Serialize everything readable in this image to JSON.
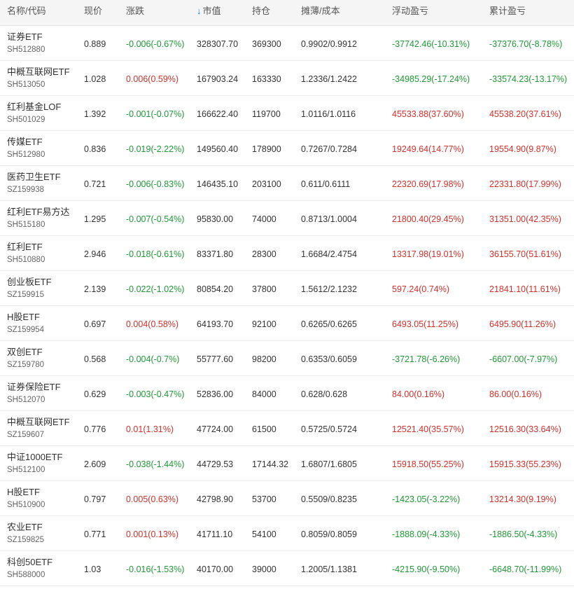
{
  "colors": {
    "up": "#d5302a",
    "down": "#1f9a36",
    "sort_arrow": "#1e78d6"
  },
  "header": {
    "name_code": "名称/代码",
    "price": "现价",
    "change": "涨跌",
    "sort_icon": "arrow-down-icon",
    "sort_arrow": "↓",
    "market_value": "市值",
    "quantity": "持仓",
    "cost": "摊薄/成本",
    "floating_pl": "浮动盈亏",
    "total_pl": "累计盈亏"
  },
  "rows": [
    {
      "name": "证券ETF",
      "code": "SH512880",
      "price": "0.889",
      "change": "-0.006(-0.67%)",
      "change_dir": "down",
      "market_value": "328307.70",
      "quantity": "369300",
      "cost": "0.9902/0.9912",
      "floating_pl": "-37742.46(-10.31%)",
      "floating_dir": "down",
      "total_pl": "-37376.70(-8.78%)",
      "total_dir": "down"
    },
    {
      "name": "中概互联网ETF",
      "code": "SH513050",
      "price": "1.028",
      "change": "0.006(0.59%)",
      "change_dir": "up",
      "market_value": "167903.24",
      "quantity": "163330",
      "cost": "1.2336/1.2422",
      "floating_pl": "-34985.29(-17.24%)",
      "floating_dir": "down",
      "total_pl": "-33574.23(-13.17%)",
      "total_dir": "down"
    },
    {
      "name": "红利基金LOF",
      "code": "SH501029",
      "price": "1.392",
      "change": "-0.001(-0.07%)",
      "change_dir": "down",
      "market_value": "166622.40",
      "quantity": "119700",
      "cost": "1.0116/1.0116",
      "floating_pl": "45533.88(37.60%)",
      "floating_dir": "up",
      "total_pl": "45538.20(37.61%)",
      "total_dir": "up"
    },
    {
      "name": "传媒ETF",
      "code": "SH512980",
      "price": "0.836",
      "change": "-0.019(-2.22%)",
      "change_dir": "down",
      "market_value": "149560.40",
      "quantity": "178900",
      "cost": "0.7267/0.7284",
      "floating_pl": "19249.64(14.77%)",
      "floating_dir": "up",
      "total_pl": "19554.90(9.87%)",
      "total_dir": "up"
    },
    {
      "name": "医药卫生ETF",
      "code": "SZ159938",
      "price": "0.721",
      "change": "-0.006(-0.83%)",
      "change_dir": "down",
      "market_value": "146435.10",
      "quantity": "203100",
      "cost": "0.611/0.6111",
      "floating_pl": "22320.69(17.98%)",
      "floating_dir": "up",
      "total_pl": "22331.80(17.99%)",
      "total_dir": "up"
    },
    {
      "name": "红利ETF易方达",
      "code": "SH515180",
      "price": "1.295",
      "change": "-0.007(-0.54%)",
      "change_dir": "down",
      "market_value": "95830.00",
      "quantity": "74000",
      "cost": "0.8713/1.0004",
      "floating_pl": "21800.40(29.45%)",
      "floating_dir": "up",
      "total_pl": "31351.00(42.35%)",
      "total_dir": "up"
    },
    {
      "name": "红利ETF",
      "code": "SH510880",
      "price": "2.946",
      "change": "-0.018(-0.61%)",
      "change_dir": "down",
      "market_value": "83371.80",
      "quantity": "28300",
      "cost": "1.6684/2.4754",
      "floating_pl": "13317.98(19.01%)",
      "floating_dir": "up",
      "total_pl": "36155.70(51.61%)",
      "total_dir": "up"
    },
    {
      "name": "创业板ETF",
      "code": "SZ159915",
      "price": "2.139",
      "change": "-0.022(-1.02%)",
      "change_dir": "down",
      "market_value": "80854.20",
      "quantity": "37800",
      "cost": "1.5612/2.1232",
      "floating_pl": "597.24(0.74%)",
      "floating_dir": "up",
      "total_pl": "21841.10(11.61%)",
      "total_dir": "up"
    },
    {
      "name": "H股ETF",
      "code": "SZ159954",
      "price": "0.697",
      "change": "0.004(0.58%)",
      "change_dir": "up",
      "market_value": "64193.70",
      "quantity": "92100",
      "cost": "0.6265/0.6265",
      "floating_pl": "6493.05(11.25%)",
      "floating_dir": "up",
      "total_pl": "6495.90(11.26%)",
      "total_dir": "up"
    },
    {
      "name": "双创ETF",
      "code": "SZ159780",
      "price": "0.568",
      "change": "-0.004(-0.7%)",
      "change_dir": "down",
      "market_value": "55777.60",
      "quantity": "98200",
      "cost": "0.6353/0.6059",
      "floating_pl": "-3721.78(-6.26%)",
      "floating_dir": "down",
      "total_pl": "-6607.00(-7.97%)",
      "total_dir": "down"
    },
    {
      "name": "证券保险ETF",
      "code": "SH512070",
      "price": "0.629",
      "change": "-0.003(-0.47%)",
      "change_dir": "down",
      "market_value": "52836.00",
      "quantity": "84000",
      "cost": "0.628/0.628",
      "floating_pl": "84.00(0.16%)",
      "floating_dir": "up",
      "total_pl": "86.00(0.16%)",
      "total_dir": "up"
    },
    {
      "name": "中概互联网ETF",
      "code": "SZ159607",
      "price": "0.776",
      "change": "0.01(1.31%)",
      "change_dir": "up",
      "market_value": "47724.00",
      "quantity": "61500",
      "cost": "0.5725/0.5724",
      "floating_pl": "12521.40(35.57%)",
      "floating_dir": "up",
      "total_pl": "12516.30(33.64%)",
      "total_dir": "up"
    },
    {
      "name": "中证1000ETF",
      "code": "SH512100",
      "price": "2.609",
      "change": "-0.038(-1.44%)",
      "change_dir": "down",
      "market_value": "44729.53",
      "quantity": "17144.32",
      "cost": "1.6807/1.6805",
      "floating_pl": "15918.50(55.25%)",
      "floating_dir": "up",
      "total_pl": "15915.33(55.23%)",
      "total_dir": "up"
    },
    {
      "name": "H股ETF",
      "code": "SH510900",
      "price": "0.797",
      "change": "0.005(0.63%)",
      "change_dir": "up",
      "market_value": "42798.90",
      "quantity": "53700",
      "cost": "0.5509/0.8235",
      "floating_pl": "-1423.05(-3.22%)",
      "floating_dir": "down",
      "total_pl": "13214.30(9.19%)",
      "total_dir": "up"
    },
    {
      "name": "农业ETF",
      "code": "SZ159825",
      "price": "0.771",
      "change": "0.001(0.13%)",
      "change_dir": "up",
      "market_value": "41711.10",
      "quantity": "54100",
      "cost": "0.8059/0.8059",
      "floating_pl": "-1888.09(-4.33%)",
      "floating_dir": "down",
      "total_pl": "-1886.50(-4.33%)",
      "total_dir": "down"
    },
    {
      "name": "科创50ETF",
      "code": "SH588000",
      "price": "1.03",
      "change": "-0.016(-1.53%)",
      "change_dir": "down",
      "market_value": "40170.00",
      "quantity": "39000",
      "cost": "1.2005/1.1381",
      "floating_pl": "-4215.90(-9.50%)",
      "floating_dir": "down",
      "total_pl": "-6648.70(-11.99%)",
      "total_dir": "down"
    }
  ]
}
